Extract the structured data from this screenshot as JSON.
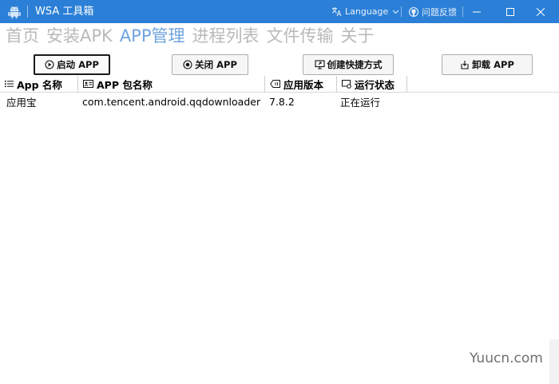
{
  "window": {
    "title": "WSA 工具箱",
    "language_label": "Language",
    "feedback_label": "问题反馈",
    "accent": "#2b7fd6"
  },
  "nav": [
    {
      "label": "首页",
      "active": false
    },
    {
      "label": "安装APK",
      "active": false
    },
    {
      "label": "APP管理",
      "active": true
    },
    {
      "label": "进程列表",
      "active": false
    },
    {
      "label": "文件传输",
      "active": false
    },
    {
      "label": "关于",
      "active": false
    }
  ],
  "toolbar": {
    "start_label": "启动 APP",
    "close_label": "关闭 APP",
    "shortcut_label": "创建快捷方式",
    "uninstall_label": "卸载 APP"
  },
  "table": {
    "columns": [
      {
        "label": "App 名称",
        "icon": "list-icon"
      },
      {
        "label": "APP 包名称",
        "icon": "id-card-icon"
      },
      {
        "label": "应用版本",
        "icon": "tag-icon"
      },
      {
        "label": "运行状态",
        "icon": "status-icon"
      }
    ],
    "rows": [
      {
        "name": "应用宝",
        "package": "com.tencent.android.qqdownloader",
        "version": "7.8.2",
        "status": "正在运行"
      }
    ]
  },
  "watermark": "Yuucn.com"
}
